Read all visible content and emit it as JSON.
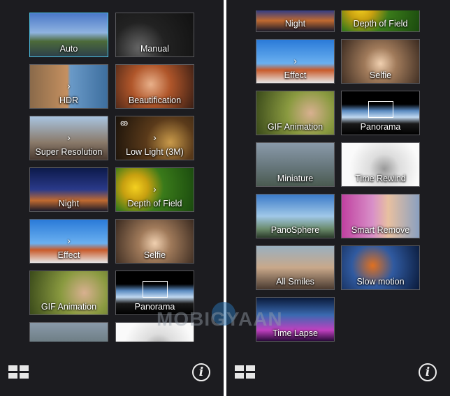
{
  "watermark": "MOBIGYAAN",
  "left_panel": {
    "modes": [
      {
        "label": "Auto",
        "selected": true
      },
      {
        "label": "Manual"
      },
      {
        "label": "HDR"
      },
      {
        "label": "Beautification"
      },
      {
        "label": "Super Resolution"
      },
      {
        "label": "Low Light (3M)"
      },
      {
        "label": "Night"
      },
      {
        "label": "Depth of Field"
      },
      {
        "label": "Effect"
      },
      {
        "label": "Selfie"
      },
      {
        "label": "GIF Animation"
      },
      {
        "label": "Panorama"
      },
      {
        "label": ""
      },
      {
        "label": ""
      }
    ],
    "grid_icon": "grid-icon",
    "info_icon": "info-icon",
    "info_glyph": "i"
  },
  "right_panel": {
    "modes": [
      {
        "label": "Night"
      },
      {
        "label": "Depth of Field"
      },
      {
        "label": "Effect"
      },
      {
        "label": "Selfie"
      },
      {
        "label": "GIF Animation"
      },
      {
        "label": "Panorama"
      },
      {
        "label": "Miniature"
      },
      {
        "label": "Time Rewind"
      },
      {
        "label": "PanoSphere"
      },
      {
        "label": "Smart Remove"
      },
      {
        "label": "All Smiles"
      },
      {
        "label": "Slow motion"
      },
      {
        "label": "Time Lapse"
      }
    ],
    "grid_icon": "grid-icon",
    "info_icon": "info-icon",
    "info_glyph": "i"
  },
  "colors": {
    "background": "#1c1c20",
    "selected_border": "#4ec3e6",
    "tile_border": "#5a5a5e"
  }
}
